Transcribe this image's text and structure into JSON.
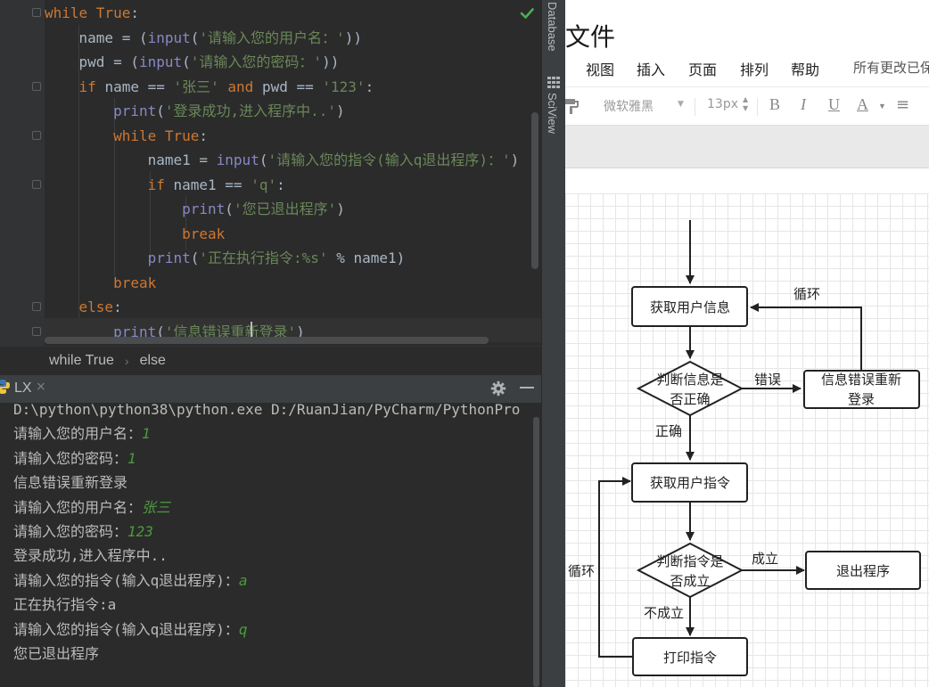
{
  "editor": {
    "lines": [
      [
        [
          "kw",
          "while "
        ],
        [
          "kw",
          "True"
        ],
        [
          "",
          ":"
        ]
      ],
      [
        [
          "",
          "    name = ("
        ],
        [
          "bi",
          "input"
        ],
        [
          "",
          "("
        ],
        [
          "str",
          "'请输入您的用户名：'"
        ],
        [
          "",
          "))"
        ]
      ],
      [
        [
          "",
          "    pwd = ("
        ],
        [
          "bi",
          "input"
        ],
        [
          "",
          "("
        ],
        [
          "str",
          "'请输入您的密码：'"
        ],
        [
          "",
          "))"
        ]
      ],
      [
        [
          "kw",
          "    if "
        ],
        [
          "",
          "name == "
        ],
        [
          "str",
          "'张三'"
        ],
        [
          "kw",
          " and "
        ],
        [
          "",
          "pwd == "
        ],
        [
          "str",
          "'123'"
        ],
        [
          "",
          ":"
        ]
      ],
      [
        [
          "bi",
          "        print"
        ],
        [
          "",
          "("
        ],
        [
          "str",
          "'登录成功,进入程序中..'"
        ],
        [
          "",
          ")"
        ]
      ],
      [
        [
          "kw",
          "        while "
        ],
        [
          "kw",
          "True"
        ],
        [
          "",
          ":"
        ]
      ],
      [
        [
          "",
          "            name1 = "
        ],
        [
          "bi",
          "input"
        ],
        [
          "",
          "("
        ],
        [
          "str",
          "'请输入您的指令(输入q退出程序)：'"
        ],
        [
          "",
          ")"
        ]
      ],
      [
        [
          "kw",
          "            if "
        ],
        [
          "",
          "name1 == "
        ],
        [
          "str",
          "'q'"
        ],
        [
          "",
          ":"
        ]
      ],
      [
        [
          "bi",
          "                print"
        ],
        [
          "",
          "("
        ],
        [
          "str",
          "'您已退出程序'"
        ],
        [
          "",
          ")"
        ]
      ],
      [
        [
          "kw",
          "                break"
        ]
      ],
      [
        [
          "bi",
          "            print"
        ],
        [
          "",
          "("
        ],
        [
          "str",
          "'正在执行指令:%s'"
        ],
        [
          "",
          " % name1)"
        ]
      ],
      [
        [
          "kw",
          "        break"
        ]
      ],
      [
        [
          "kw",
          "    else"
        ],
        [
          "",
          ":"
        ]
      ],
      [
        [
          "bi",
          "        print"
        ],
        [
          "",
          "("
        ],
        [
          "str",
          "'信息错误重新登录'"
        ],
        [
          "",
          ")"
        ]
      ]
    ]
  },
  "breadcrumb": {
    "first": "while True",
    "second": "else"
  },
  "run_panel": {
    "tab_title": "LX",
    "close": "×"
  },
  "console": {
    "lines": [
      [
        [
          "",
          "D:\\python\\python38\\python.exe D:/RuanJian/PyCharm/PythonPro"
        ]
      ],
      [
        [
          "",
          "请输入您的用户名："
        ],
        [
          "in",
          "1"
        ]
      ],
      [
        [
          "",
          "请输入您的密码："
        ],
        [
          "in",
          "1"
        ]
      ],
      [
        [
          "",
          "信息错误重新登录"
        ]
      ],
      [
        [
          "",
          "请输入您的用户名："
        ],
        [
          "in",
          "张三"
        ]
      ],
      [
        [
          "",
          "请输入您的密码："
        ],
        [
          "in",
          "123"
        ]
      ],
      [
        [
          "",
          "登录成功,进入程序中.."
        ]
      ],
      [
        [
          "",
          "请输入您的指令(输入q退出程序)："
        ],
        [
          "in",
          "a"
        ]
      ],
      [
        [
          "",
          "正在执行指令:a"
        ]
      ],
      [
        [
          "",
          "请输入您的指令(输入q退出程序)："
        ],
        [
          "in",
          "q"
        ]
      ],
      [
        [
          "",
          "您已退出程序"
        ]
      ]
    ]
  },
  "tool_strip": {
    "database": "Database",
    "sciview": "SciView"
  },
  "diagram_app": {
    "title": "文件",
    "menu": [
      "视图",
      "插入",
      "页面",
      "排列",
      "帮助"
    ],
    "status": "所有更改已保",
    "font_name": "微软雅黑",
    "font_size": "13px",
    "format_buttons": [
      "B",
      "I",
      "U",
      "A",
      "≡"
    ]
  },
  "flowchart": {
    "nodes": {
      "get_user_info": "获取用户信息",
      "check_info_1": "判断信息是",
      "check_info_2": "否正确",
      "error_relogin_1": "信息错误重新",
      "error_relogin_2": "登录",
      "get_command": "获取用户指令",
      "check_cmd_1": "判断指令是",
      "check_cmd_2": "否成立",
      "exit_program": "退出程序",
      "print_command": "打印指令"
    },
    "edge_labels": {
      "loop_top": "循环",
      "error": "错误",
      "correct": "正确",
      "holds": "成立",
      "not_holds": "不成立",
      "loop_left": "循环"
    }
  },
  "colors": {
    "keyword": "#cc7832",
    "builtin": "#8888c6",
    "string": "#6a8759",
    "console_input": "#4c9a3e",
    "editor_bg": "#2b2b2b",
    "accent_check": "#4caf50"
  }
}
